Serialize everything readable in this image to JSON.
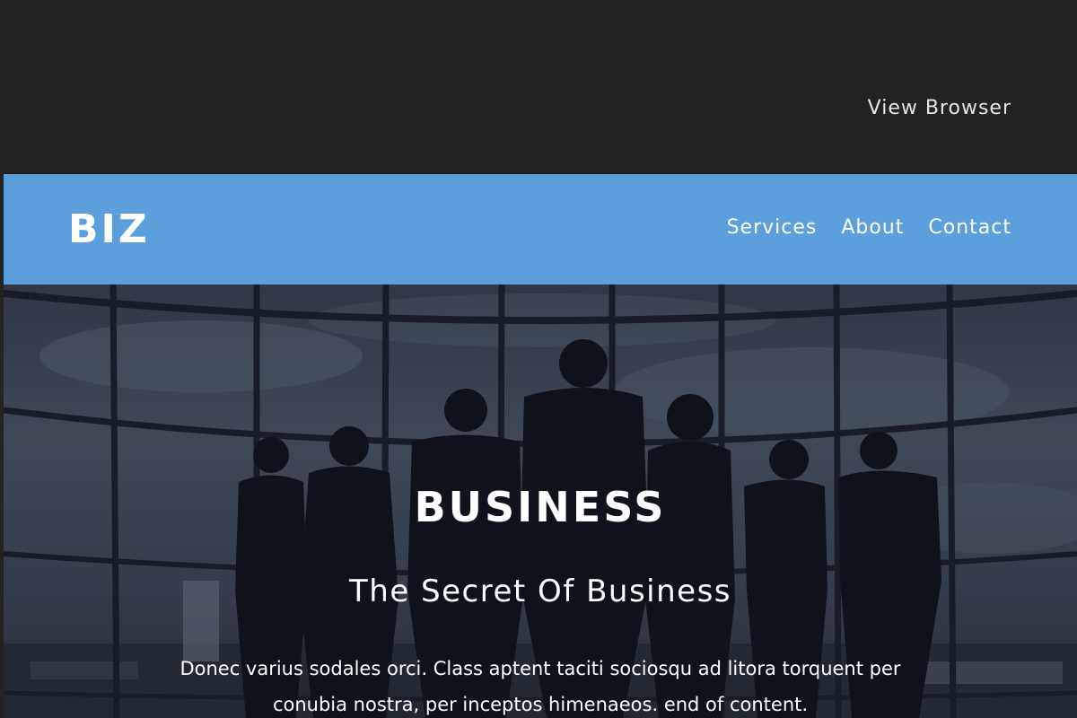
{
  "topbar": {
    "view_browser_label": "View Browser"
  },
  "nav": {
    "logo": "BIZ",
    "links": [
      "Services",
      "About",
      "Contact"
    ]
  },
  "hero": {
    "title": "BUSINESS",
    "subtitle": "The Secret Of Business",
    "body": "Donec varius sodales orci. Class aptent taciti sociosqu ad litora torquent per conubia nostra, per inceptos himenaeos. end of content.",
    "image": "business-team-silhouette"
  },
  "colors": {
    "topbar_bg": "#232323",
    "nav_bg": "#5b9fdc",
    "text": "#ffffff"
  }
}
